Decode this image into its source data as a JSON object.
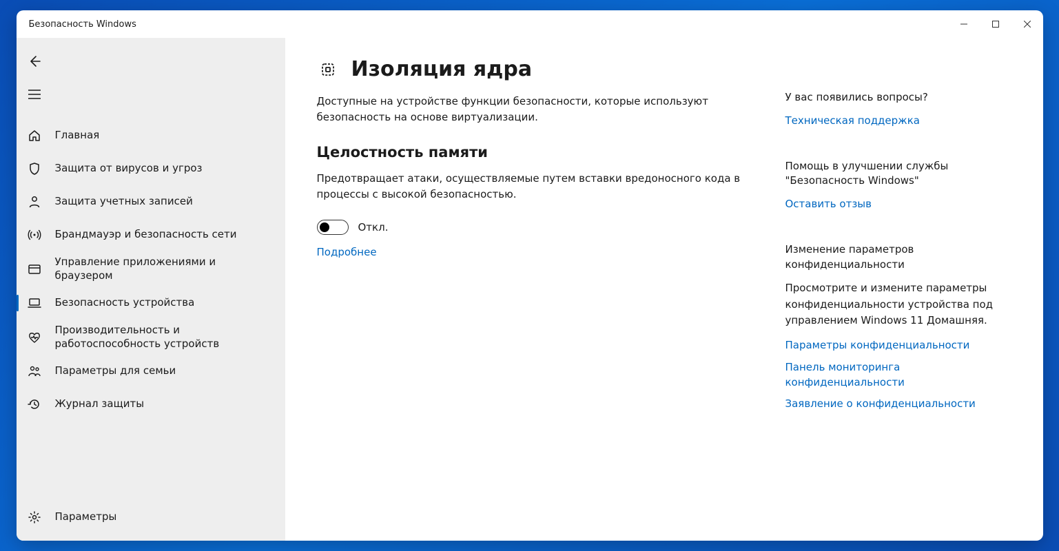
{
  "window": {
    "title": "Безопасность Windows"
  },
  "sidebar": {
    "items": [
      {
        "label": "Главная"
      },
      {
        "label": "Защита от вирусов и угроз"
      },
      {
        "label": "Защита учетных записей"
      },
      {
        "label": "Брандмауэр и безопасность сети"
      },
      {
        "label": "Управление приложениями и браузером"
      },
      {
        "label": "Безопасность устройства"
      },
      {
        "label": "Производительность и работоспособность устройств"
      },
      {
        "label": "Параметры для семьи"
      },
      {
        "label": "Журнал защиты"
      }
    ],
    "settings_label": "Параметры"
  },
  "page": {
    "title": "Изоляция ядра",
    "lead": "Доступные на устройстве функции безопасности, которые используют безопасность на основе виртуализации.",
    "section1": {
      "heading": "Целостность памяти",
      "desc": "Предотвращает атаки, осуществляемые путем вставки вредоносного кода в процессы с высокой безопасностью.",
      "toggle_state": "Откл.",
      "learn_more": "Подробнее"
    }
  },
  "aside": {
    "help": {
      "heading": "У вас появились вопросы?",
      "link": "Техническая поддержка"
    },
    "feedback": {
      "heading": "Помощь в улучшении службы \"Безопасность Windows\"",
      "link": "Оставить отзыв"
    },
    "privacy": {
      "heading": "Изменение параметров конфиденциальности",
      "text": "Просмотрите и измените параметры конфиденциальности устройства под управлением Windows 11 Домашняя.",
      "links": [
        "Параметры конфиденциальности",
        "Панель мониторинга конфиденциальности",
        "Заявление о конфиденциальности"
      ]
    }
  }
}
